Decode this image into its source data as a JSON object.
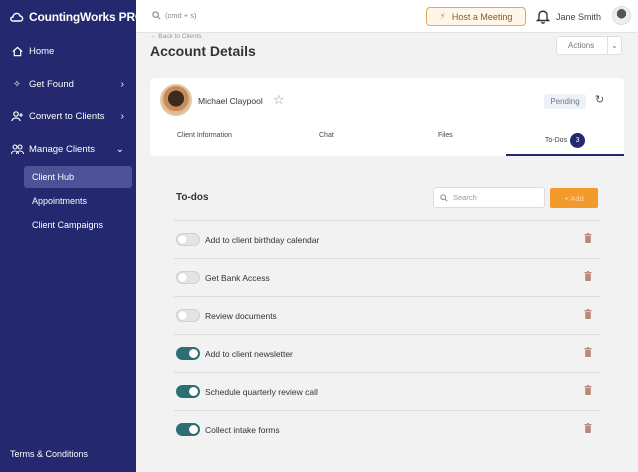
{
  "sidebar": {
    "logo": "CountingWorks PRO",
    "items": [
      {
        "label": "Home",
        "icon": "home-icon"
      },
      {
        "label": "Get Found",
        "icon": "sparkle-icon"
      },
      {
        "label": "Convert to Clients",
        "icon": "user-plus-icon"
      },
      {
        "label": "Manage Clients",
        "icon": "users-icon"
      }
    ],
    "subitems": [
      {
        "label": "Client Hub",
        "active": true
      },
      {
        "label": "Appointments",
        "active": false
      },
      {
        "label": "Client Campaigns",
        "active": false
      }
    ],
    "footer": "Terms & Conditions",
    "bg_color": "#23286f"
  },
  "topbar": {
    "search_hint": "(cmd + s)",
    "host_button": "Host a Meeting",
    "username": "Jane Smith"
  },
  "header": {
    "back_link": "← Back to Clients",
    "title": "Account Details",
    "actions_label": "Actions"
  },
  "client": {
    "name": "Michael Claypool",
    "status": "Pending",
    "tabs": [
      "Client Information",
      "Chat",
      "Files",
      "To-Dos"
    ],
    "todo_count": "3"
  },
  "todos": {
    "title": "To-dos",
    "search_placeholder": "Search",
    "add_label": "+ Add",
    "accent_color": "#f39a2c",
    "toggle_on_color": "#2b6f74",
    "items": [
      {
        "label": "Add to client birthday calendar",
        "done": false
      },
      {
        "label": "Get Bank Access",
        "done": false
      },
      {
        "label": "Review documents",
        "done": false
      },
      {
        "label": "Add to client newsletter",
        "done": true
      },
      {
        "label": "Schedule quarterly review call",
        "done": true
      },
      {
        "label": "Collect intake forms",
        "done": true
      }
    ]
  }
}
